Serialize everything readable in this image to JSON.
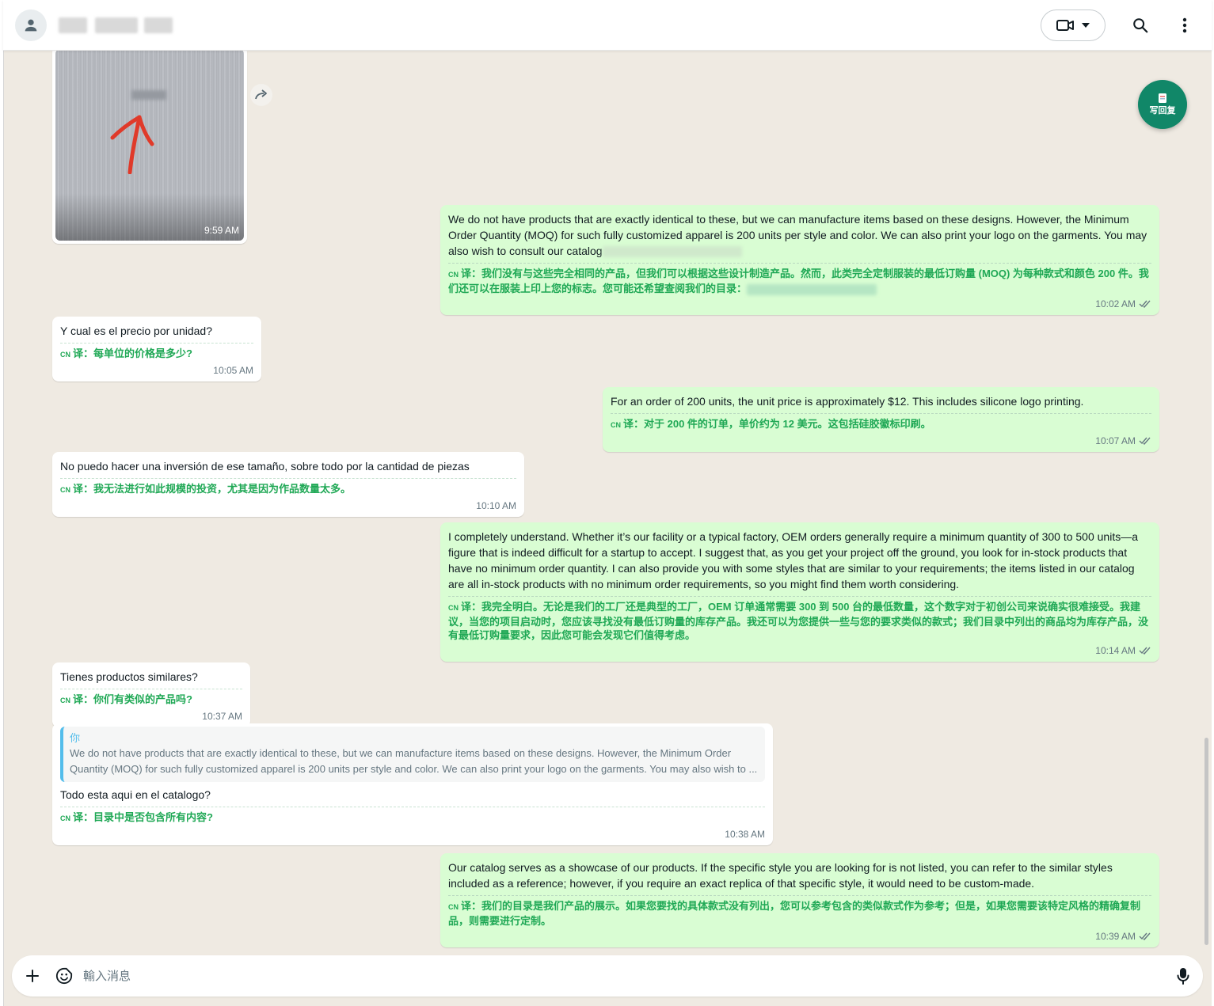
{
  "header": {
    "video_call_icon": "video-camera-icon",
    "search_icon": "search-icon",
    "menu_icon": "more-vertical-icon"
  },
  "fab": {
    "label": "写回复"
  },
  "image_message": {
    "time": "9:59 AM"
  },
  "messages": [
    {
      "direction": "out",
      "text": "We do not have products that are exactly identical to these, but we can manufacture items based on these designs. However, the Minimum Order Quantity (MOQ) for such fully customized apparel is 200 units per style and color. We can also print your logo on the garments. You may also wish to consult our catalog",
      "translation_prefix": "CN",
      "translation": "译：我们没有与这些完全相同的产品，但我们可以根据这些设计制造产品。然而，此类完全定制服装的最低订购量 (MOQ) 为每种款式和颜色 200 件。我们还可以在服装上印上您的标志。您可能还希望查阅我们的目录：",
      "time": "10:02 AM"
    },
    {
      "direction": "in",
      "text": "Y cual es el precio por unidad?",
      "translation_prefix": "CN",
      "translation": "译：每单位的价格是多少?",
      "time": "10:05 AM"
    },
    {
      "direction": "out",
      "text": "For an order of 200 units, the unit price is approximately $12. This includes silicone logo printing.",
      "translation_prefix": "CN",
      "translation": "译：对于 200 件的订单，单价约为 12 美元。这包括硅胶徽标印刷。",
      "time": "10:07 AM"
    },
    {
      "direction": "in",
      "text": "No puedo hacer una inversión de ese tamaño, sobre todo por la cantidad de piezas",
      "translation_prefix": "CN",
      "translation": "译：我无法进行如此规模的投资，尤其是因为作品数量太多。",
      "time": "10:10 AM"
    },
    {
      "direction": "out",
      "text": "I completely understand. Whether it’s our facility or a typical factory, OEM orders generally require a minimum quantity of 300 to 500 units—a figure that is indeed difficult for a startup to accept. I suggest that, as you get your project off the ground, you look for in-stock products that have no minimum order quantity. I can also provide you with some styles that are similar to your requirements; the items listed in our catalog are all in-stock products with no minimum order requirements, so you might find them worth considering.",
      "translation_prefix": "CN",
      "translation": "译：我完全明白。无论是我们的工厂还是典型的工厂，OEM 订单通常需要 300 到 500 台的最低数量，这个数字对于初创公司来说确实很难接受。我建议，当您的项目启动时，您应该寻找没有最低订购量的库存产品。我还可以为您提供一些与您的要求类似的款式；我们目录中列出的商品均为库存产品，没有最低订购量要求，因此您可能会发现它们值得考虑。",
      "time": "10:14 AM"
    },
    {
      "direction": "in",
      "text": "Tienes productos similares?",
      "translation_prefix": "CN",
      "translation": "译：你们有类似的产品吗?",
      "time": "10:37 AM"
    },
    {
      "direction": "in",
      "quote_author": "你",
      "quote_text": "We do not have products that are exactly identical to these, but we can manufacture items based on these designs. However, the Minimum Order Quantity (MOQ) for such fully customized apparel is 200 units per style and color. We can also print your logo on the garments. You may also wish to ...",
      "text": "Todo esta aqui en el catalogo?",
      "translation_prefix": "CN",
      "translation": "译：目录中是否包含所有内容?",
      "time": "10:38 AM"
    },
    {
      "direction": "out",
      "text": "Our catalog serves as a showcase of our products. If the specific style you are looking for is not listed, you can refer to the similar styles included as a reference; however, if you require an exact replica of that specific style, it would need to be custom-made.",
      "translation_prefix": "CN",
      "translation": "译：我们的目录是我们产品的展示。如果您要找的具体款式没有列出，您可以参考包含的类似款式作为参考；但是，如果您需要该特定风格的精确复制品，则需要进行定制。",
      "time": "10:39 AM"
    }
  ],
  "composer": {
    "placeholder": "輸入消息",
    "add_icon": "plus-icon",
    "emoji_icon": "sticker-emoji-icon",
    "mic_icon": "microphone-icon"
  }
}
